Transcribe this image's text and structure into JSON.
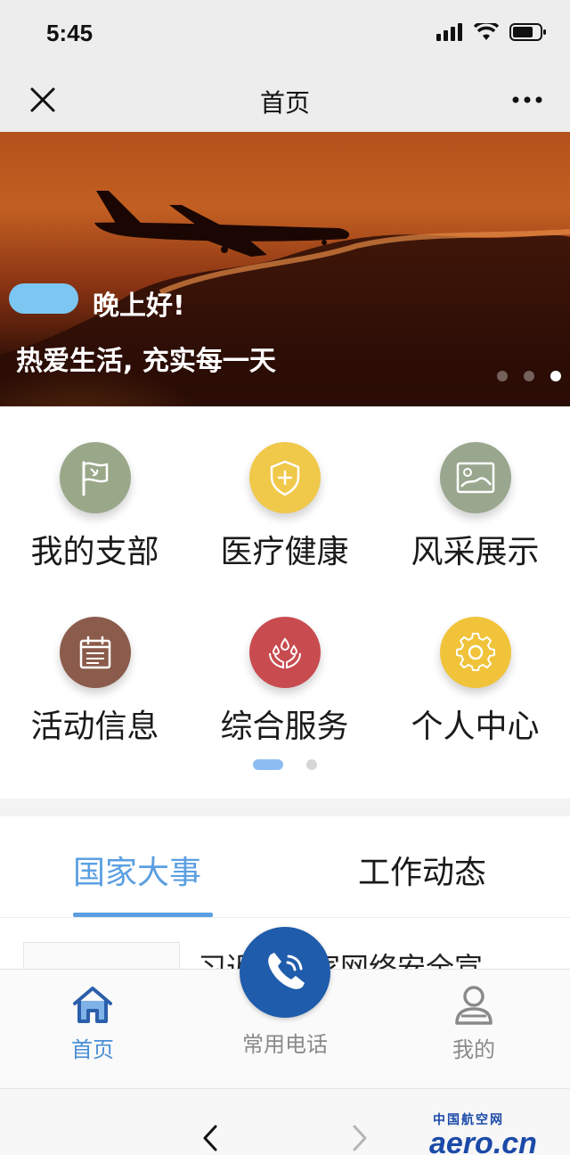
{
  "status": {
    "time": "5:45"
  },
  "nav": {
    "title": "首页"
  },
  "banner": {
    "greeting": "晚上好!",
    "slogan": "热爱生活, 充实每一天",
    "slides": 3,
    "active_slide": 3
  },
  "grid": {
    "items": [
      {
        "label": "我的支部",
        "icon": "party-flag-icon",
        "color": "#9aa88a"
      },
      {
        "label": "医疗健康",
        "icon": "medical-shield-icon",
        "color": "#f0c84a"
      },
      {
        "label": "风采展示",
        "icon": "image-gallery-icon",
        "color": "#98a78e"
      },
      {
        "label": "活动信息",
        "icon": "calendar-icon",
        "color": "#8b5b4b"
      },
      {
        "label": "综合服务",
        "icon": "hands-drops-icon",
        "color": "#c84b50"
      },
      {
        "label": "个人中心",
        "icon": "gear-icon",
        "color": "#f0c33a"
      }
    ],
    "pages": 2,
    "active_page": 1
  },
  "tabs": [
    {
      "label": "国家大事",
      "active": true
    },
    {
      "label": "工作动态",
      "active": false
    }
  ],
  "news": {
    "title": "习近平国家网络安全宣"
  },
  "tabbar": {
    "home": "首页",
    "phone": "常用电话",
    "mine": "我的"
  },
  "watermark": {
    "top": "中国航空网",
    "main": "aero.cn"
  },
  "colors": {
    "accent": "#5b9fe2",
    "phone_button": "#1f5cab"
  }
}
